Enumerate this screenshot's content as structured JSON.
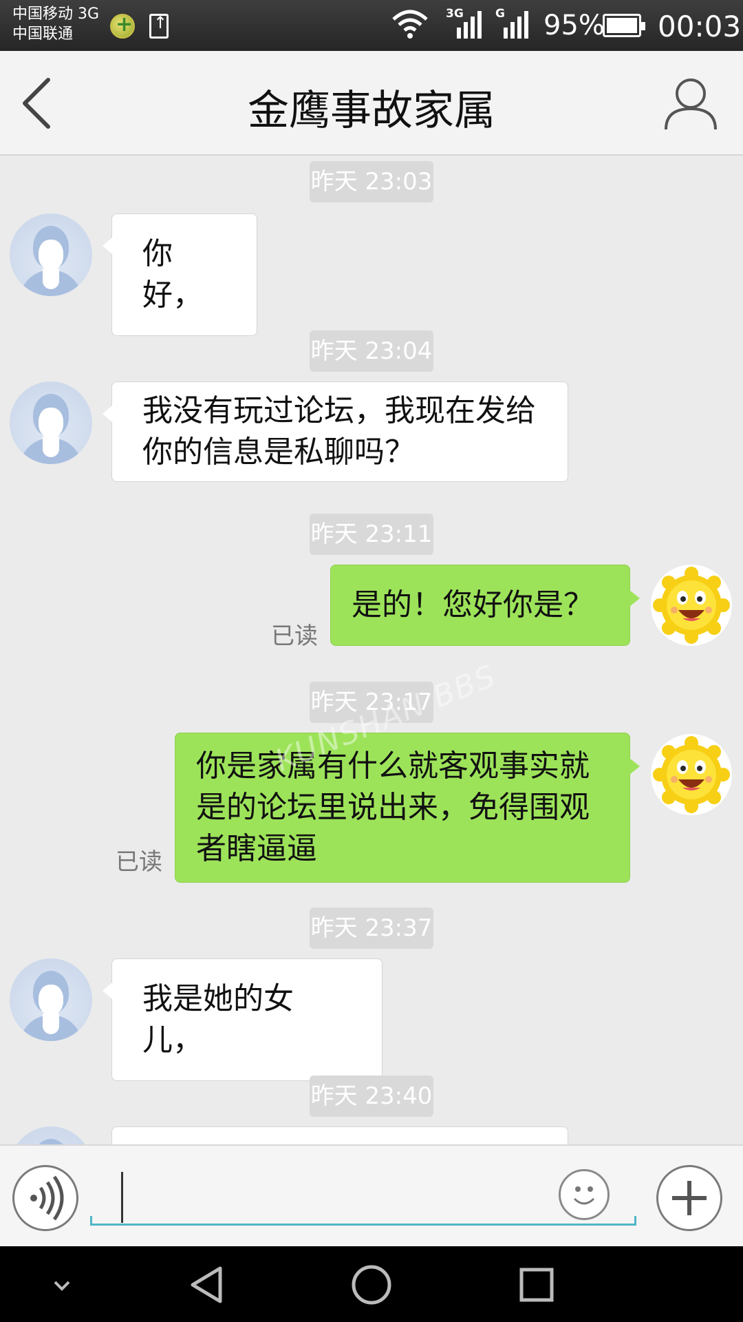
{
  "status_bar": {
    "carrier_1": "中国移动 3G",
    "carrier_2": "中国联通",
    "net_1": "3G",
    "net_2": "G",
    "battery": "95%",
    "time": "00:03",
    "icons": [
      "app-badge-icon",
      "upload-icon",
      "wifi-icon",
      "signal-icon",
      "battery-icon"
    ]
  },
  "header": {
    "title": "金鹰事故家属"
  },
  "chat": {
    "timestamps": [
      "昨天 23:03",
      "昨天 23:04",
      "昨天 23:11",
      "昨天 23:17",
      "昨天 23:37",
      "昨天 23:40"
    ],
    "messages": [
      {
        "direction": "in",
        "text": "你好，"
      },
      {
        "direction": "in",
        "lines": [
          "我没有玩过论坛，我现在发给",
          "你的信息是私聊吗？"
        ]
      },
      {
        "direction": "out",
        "text": "是的！您好你是？",
        "status": "已读"
      },
      {
        "direction": "out",
        "lines": [
          "你是家属有什么就客观事实就",
          "是的论坛里说出来，免得围观",
          "者瞎逼逼"
        ],
        "status": "已读"
      },
      {
        "direction": "in",
        "text": "我是她的女儿，"
      }
    ],
    "watermark": "KUNSHAN BBS",
    "colors": {
      "outgoing_bubble": "#9de35a",
      "incoming_bubble": "#ffffff",
      "background": "#ebebeb",
      "accent": "#4fb6c5"
    }
  },
  "input_bar": {
    "value": "",
    "icons": [
      "voice-icon",
      "emoji-icon",
      "plus-icon"
    ]
  },
  "nav_bar": {
    "icons": [
      "hide-keyboard-icon",
      "back-triangle-icon",
      "home-circle-icon",
      "recents-square-icon"
    ]
  }
}
